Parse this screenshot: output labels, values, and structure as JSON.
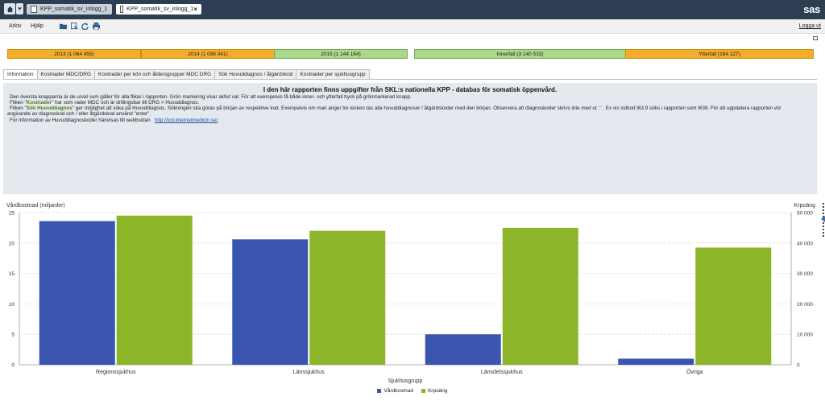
{
  "topbar": {
    "tabs": [
      {
        "label": "KPP_somatik_sv_inlogg_1",
        "active": false
      },
      {
        "label": "KPP_somatik_sv_inlogg_1",
        "active": true
      }
    ],
    "close_symbol": "×",
    "logo": "sas"
  },
  "menubar": {
    "items": [
      "Arkiv",
      "Hjälp"
    ],
    "toolbar_icons": [
      "folder-icon",
      "filter-icon",
      "refresh-icon",
      "print-icon"
    ],
    "logout": "Logga ut"
  },
  "filters": {
    "years": [
      {
        "label": "2013 (1 064 455)",
        "state": "unselected"
      },
      {
        "label": "2014 (1 096 041)",
        "state": "unselected"
      },
      {
        "label": "2015 (1 144 164)",
        "state": "selected"
      }
    ],
    "types": [
      {
        "label": "Innerfall (3 140 533)",
        "state": "selected"
      },
      {
        "label": "Ytterfall (164 127)",
        "state": "unselected"
      }
    ],
    "colors": {
      "selected": "#a9d989",
      "unselected": "#f4ac2c"
    }
  },
  "report_tabs": [
    "Information",
    "Kostnader MDC/DRG",
    "Kostnader per kön och åldersgrupper MDC DRG",
    "Sök Huvuddiagnos / åtgärdskod",
    "Kostnader per sjukhusgrupp"
  ],
  "info": {
    "title": "I den här rapporten finns uppgifter från SKL:s nationella KPP - databas för somatisk öppenvård.",
    "line1": "Den översta knapparna är de urval som gäller för alla flikar i rapporten. Grön markering visar aktivt val. För att exempelvis få både inner- och ytterfall tryck på grönmarkerad knapp.",
    "line2_prefix": "Fliken \"",
    "line2_hl": "Kostnader",
    "line2_suffix": "\" har som rader MDC och är drillingsbar  till DRG > Huvuddiagnos.",
    "line3_prefix": "Fliken \"",
    "line3_hl": "Sök Huvuddiagnos",
    "line3_suffix": "\"  ger möjlighet att söka på Huvuddiagnos. Sökningen ska göras på början av respektive kod. Exempelvis om man anger tre tecken tas alla huvuddiagnoser / åtgärdskoder med den början. Observera att diagnoskoder skrivs inte med ut '.' . Ex vis icdkod I63.9 söks i rapporten som I639. För att uppdatera rapporten vid",
    "line4": "angivande av diagnoskod och / eller åtgärdskod använd \"enter\".",
    "line5": "För information av Huvuddiagnoskoder hänvisas till webbsidan",
    "link": "http://icd.internetmedicin.se/"
  },
  "chart_data": {
    "type": "bar",
    "categories": [
      "Regionssjukhus",
      "Länssjukhus",
      "Länsdelssjukhus",
      "Övriga"
    ],
    "series": [
      {
        "name": "Vårdkostnad",
        "axis": "left",
        "color": "#3a55b0",
        "values": [
          23.6,
          20.6,
          5.0,
          1.0
        ]
      },
      {
        "name": "Krpoäng",
        "axis": "right",
        "color": "#8cb52a",
        "values": [
          49000,
          44000,
          45000,
          38500
        ]
      }
    ],
    "ylabel": "Vårdkostnad (miljarder)",
    "ylabel_right": "Krpoäng",
    "xlabel": "Sjukhusgrupp",
    "ylim": [
      0,
      25
    ],
    "ylim_right": [
      0,
      50000
    ],
    "yticks": [
      "0",
      "5",
      "10",
      "15",
      "20",
      "25"
    ],
    "yticks_right": [
      "0",
      "10 000",
      "20 000",
      "30 000",
      "40 000",
      "50 000"
    ],
    "grid": true,
    "legend": "bottom-center"
  }
}
